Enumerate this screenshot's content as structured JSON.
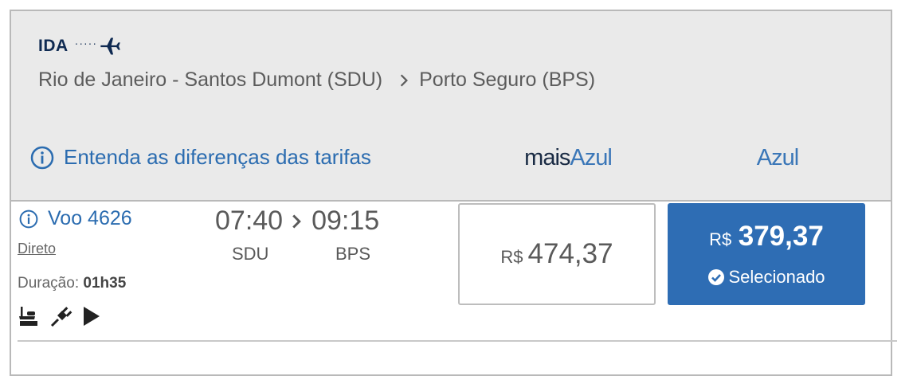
{
  "header": {
    "direction_label": "IDA",
    "direction_dots": "·····",
    "origin": "Rio de Janeiro - Santos Dumont (SDU)",
    "destination": "Porto Seguro (BPS)",
    "fare_info_link": "Entenda as diferenças das tarifas",
    "fare_columns": {
      "mais_azul": {
        "prefix": "mais",
        "suffix": "Azul"
      },
      "azul": "Azul"
    }
  },
  "flight": {
    "number_label": "Voo 4626",
    "type": "Direto",
    "duration_label": "Duração:",
    "duration_value": "01h35",
    "departure_time": "07:40",
    "arrival_time": "09:15",
    "origin_code": "SDU",
    "destination_code": "BPS",
    "amenity_icons": [
      "food-icon",
      "power-plug-icon",
      "entertainment-play-icon"
    ]
  },
  "prices": {
    "mais_azul": {
      "currency": "R$",
      "value": "474,37"
    },
    "azul": {
      "currency": "R$",
      "value": "379,37",
      "status": "Selecionado"
    }
  },
  "colors": {
    "navy": "#0f2a52",
    "link_blue": "#2b6cb0",
    "selected_bg": "#2e6db4",
    "header_bg": "#eaeaea"
  }
}
